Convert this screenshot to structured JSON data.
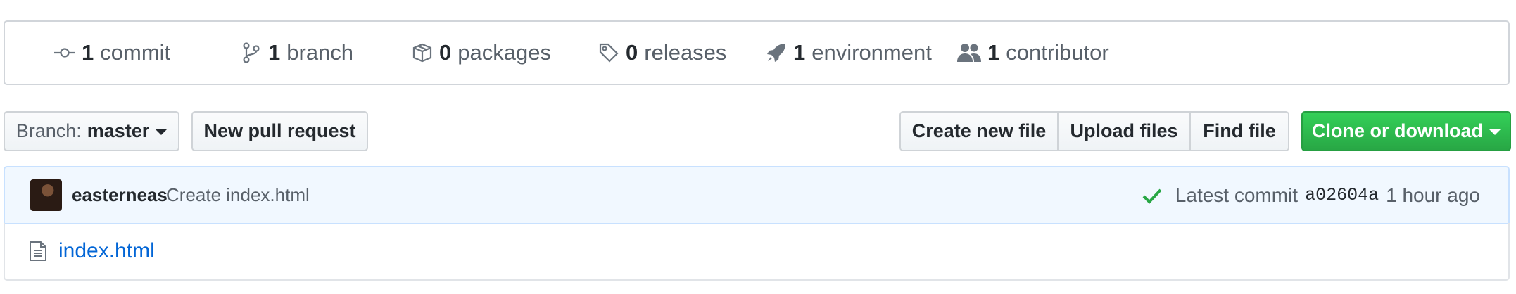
{
  "summary": {
    "commits": {
      "count": "1",
      "label": "commit",
      "icon": "commit-icon"
    },
    "branches": {
      "count": "1",
      "label": "branch",
      "icon": "branch-icon"
    },
    "packages": {
      "count": "0",
      "label": "packages",
      "icon": "package-icon"
    },
    "releases": {
      "count": "0",
      "label": "releases",
      "icon": "tag-icon"
    },
    "environments": {
      "count": "1",
      "label": "environment",
      "icon": "rocket-icon"
    },
    "contributors": {
      "count": "1",
      "label": "contributor",
      "icon": "people-icon"
    }
  },
  "toolbar": {
    "branch_label": "Branch:",
    "branch_value": "master",
    "new_pull_request": "New pull request",
    "create_new_file": "Create new file",
    "upload_files": "Upload files",
    "find_file": "Find file",
    "clone_or_download": "Clone or download"
  },
  "latest_commit": {
    "author": "easterneas",
    "message": "Create index.html",
    "status_icon": "check-icon",
    "label": "Latest commit",
    "sha": "a02604a",
    "time": "1 hour ago"
  },
  "files": [
    {
      "name": "index.html",
      "icon": "file-icon"
    }
  ],
  "colors": {
    "accent_green": "#28a745",
    "link_blue": "#0366d6",
    "commit_bar_bg": "#f1f8ff"
  }
}
